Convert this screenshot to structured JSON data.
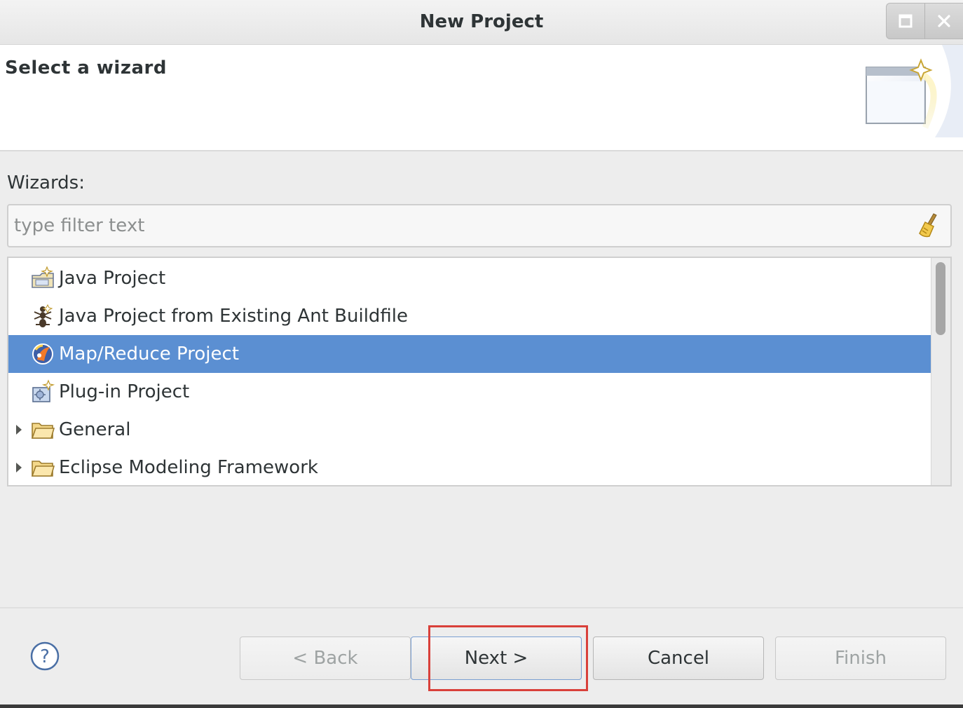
{
  "window": {
    "title": "New Project",
    "controls": [
      {
        "name": "maximize",
        "icon": "maximize-icon"
      },
      {
        "name": "close",
        "icon": "close-icon"
      }
    ]
  },
  "header": {
    "title": "Select a wizard",
    "banner_icon": "new-wizard-banner-icon"
  },
  "wizards": {
    "label": "Wizards:",
    "filter_placeholder": "type filter text",
    "filter_value": "",
    "clear_icon": "clear-filter-broom-icon",
    "items": [
      {
        "label": "Java Project",
        "icon": "java-project-icon",
        "expandable": false,
        "selected": false
      },
      {
        "label": "Java Project from Existing Ant Buildfile",
        "icon": "ant-buildfile-icon",
        "expandable": false,
        "selected": false
      },
      {
        "label": "Map/Reduce Project",
        "icon": "mapreduce-project-icon",
        "expandable": false,
        "selected": true
      },
      {
        "label": "Plug-in Project",
        "icon": "plugin-project-icon",
        "expandable": false,
        "selected": false
      },
      {
        "label": "General",
        "icon": "folder-icon",
        "expandable": true,
        "selected": false
      },
      {
        "label": "Eclipse Modeling Framework",
        "icon": "folder-icon",
        "expandable": true,
        "selected": false
      }
    ]
  },
  "buttons": {
    "help_icon": "help-icon",
    "back": "< Back",
    "next": "Next >",
    "cancel": "Cancel",
    "finish": "Finish"
  },
  "colors": {
    "selection": "#5b8fd2",
    "highlight_box": "#d9403a"
  }
}
